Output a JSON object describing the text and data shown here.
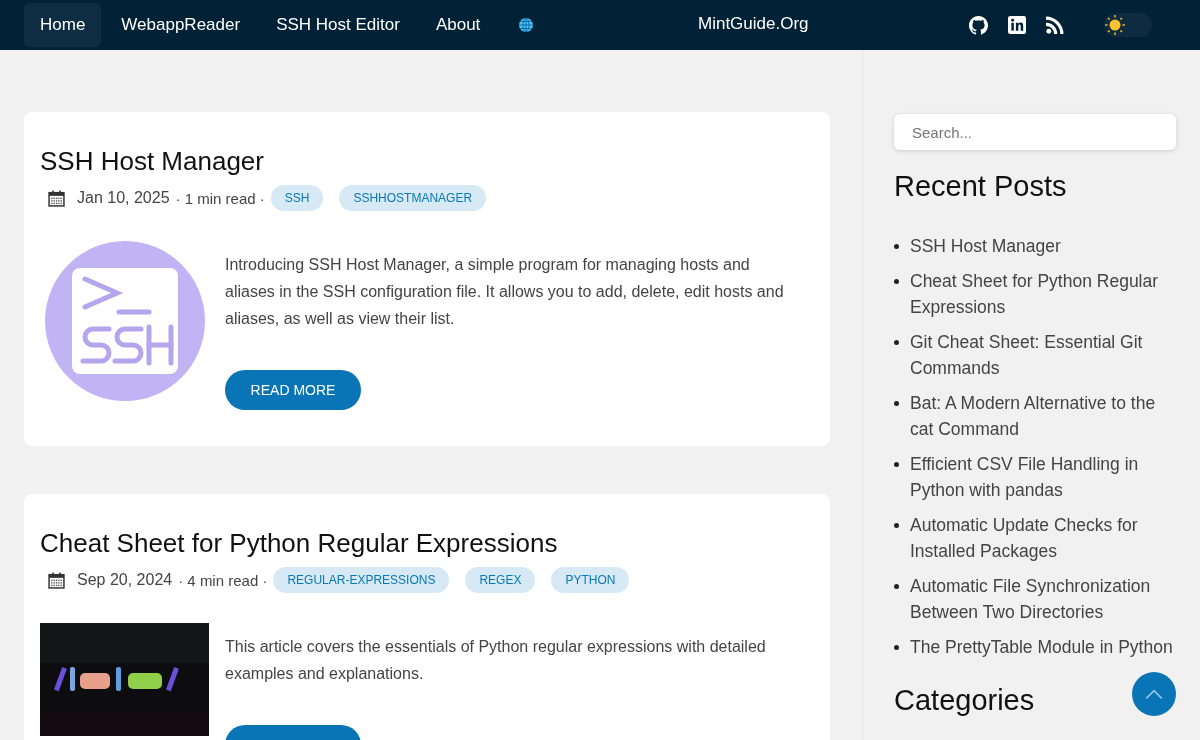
{
  "nav": {
    "items": [
      {
        "label": "Home",
        "selected": true
      },
      {
        "label": "WebappReader",
        "selected": false
      },
      {
        "label": "SSH Host Editor",
        "selected": false
      },
      {
        "label": "About",
        "selected": false
      }
    ],
    "site_title": "MintGuide.Org",
    "theme_toggle": {
      "on": false
    }
  },
  "posts": [
    {
      "title": "SSH Host Manager",
      "date": "Jan 10, 2025",
      "read_time": "· 1 min read ·",
      "tags": [
        "SSH",
        "SSHHOSTMANAGER"
      ],
      "thumbnail": {
        "kind": "logo"
      },
      "summary": "Introducing SSH Host Manager, a simple program for managing hosts and aliases in the SSH configuration file. It allows you to add, delete, edit hosts and aliases, as well as view their list.",
      "button": "READ MORE"
    },
    {
      "title": "Cheat Sheet for Python Regular Expressions",
      "date": "Sep 20, 2024",
      "read_time": "· 4 min read ·",
      "tags": [
        "REGULAR-EXPRESSIONS",
        "REGEX",
        "PYTHON"
      ],
      "thumbnail": {
        "kind": "picture"
      },
      "summary": "This article covers the essentials of Python regular expressions with detailed examples and explanations."
    }
  ],
  "sidebar": {
    "search": {
      "placeholder": "Search..."
    },
    "recent_title": "Recent Posts",
    "recent_posts": [
      "SSH Host Manager",
      "Cheat Sheet for Python Regular Expressions",
      "Git Cheat Sheet: Essential Git Commands",
      "Bat: A Modern Alternative to the cat Command",
      "Efficient CSV File Handling in Python with pandas",
      "Automatic Update Checks for Installed Packages",
      "Automatic File Synchronization Between Two Directories",
      "The PrettyTable Module in Python"
    ],
    "categories_title": "Categories"
  }
}
